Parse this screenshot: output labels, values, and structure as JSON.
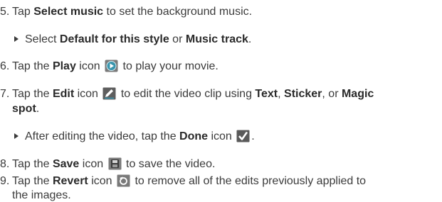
{
  "steps": {
    "s5": {
      "num": "5.",
      "t1": "Tap ",
      "b1": "Select music",
      "t2": " to set the background music."
    },
    "s5a": {
      "t1": "Select ",
      "b1": "Default for this style",
      "t2": " or ",
      "b2": "Music track",
      "t3": "."
    },
    "s6": {
      "num": "6.",
      "t1": "Tap the ",
      "b1": "Play",
      "t2": " icon ",
      "t3": " to play your movie."
    },
    "s7": {
      "num": "7.",
      "t1": "Tap the ",
      "b1": "Edit",
      "t2": " icon ",
      "t3": " to edit the video clip using ",
      "b2": "Text",
      "t4": ", ",
      "b3": "Sticker",
      "t5": ", or ",
      "b4": "Magic",
      "b5": "spot",
      "t6": "."
    },
    "s7a": {
      "t1": "After editing the video, tap the ",
      "b1": "Done",
      "t2": " icon ",
      "t3": "."
    },
    "s8": {
      "num": "8.",
      "t1": "Tap the ",
      "b1": "Save",
      "t2": " icon ",
      "t3": " to save the video."
    },
    "s9": {
      "num": "9.",
      "t1": "Tap the ",
      "b1": "Revert",
      "t2": " icon ",
      "t3": " to remove all of the edits previously applied to",
      "t4": "the images."
    }
  },
  "icons": {
    "play": "play-icon",
    "edit": "edit-icon",
    "done": "checkmark-icon",
    "save": "save-icon",
    "revert": "revert-icon"
  }
}
